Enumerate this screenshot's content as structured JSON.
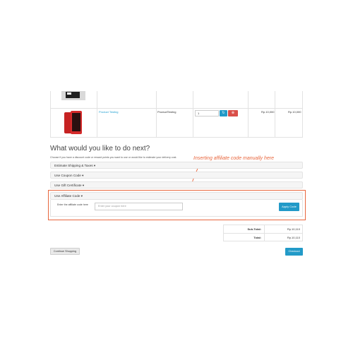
{
  "cart": {
    "product": {
      "name": "Product Testing",
      "model": "ProductTesting",
      "quantity": "1",
      "unit_price": "Rp.10,000",
      "total": "Rp.10,000"
    },
    "refresh_icon": "refresh-icon",
    "remove_icon": "remove-icon"
  },
  "next": {
    "heading": "What would you like to do next?",
    "description": "Choose if you have a discount code or reward points you want to use or would like to estimate your delivery cost."
  },
  "annotation": {
    "text": "Inserting affiliate code manually here",
    "color": "#e8663d"
  },
  "panels": [
    {
      "title": "Estimate Shipping & Taxes ▾"
    },
    {
      "title": "Use Coupon Code ▾"
    },
    {
      "title": "Use Gift Certificate ▾"
    },
    {
      "title": "Use Affiliate Code ▾"
    }
  ],
  "affiliate": {
    "label": "Enter the affiliate code here",
    "placeholder": "Enter your coupon here",
    "apply_label": "Apply Code"
  },
  "totals": {
    "sub_total_label": "Sub-Total:",
    "sub_total_value": "Rp.10,110",
    "total_label": "Total:",
    "total_value": "Rp.10,110"
  },
  "actions": {
    "continue_label": "Continue Shopping",
    "checkout_label": "Checkout"
  },
  "colors": {
    "primary": "#229ac8",
    "danger": "#da4f49",
    "link": "#23a1d1",
    "highlight": "#e8663d"
  }
}
